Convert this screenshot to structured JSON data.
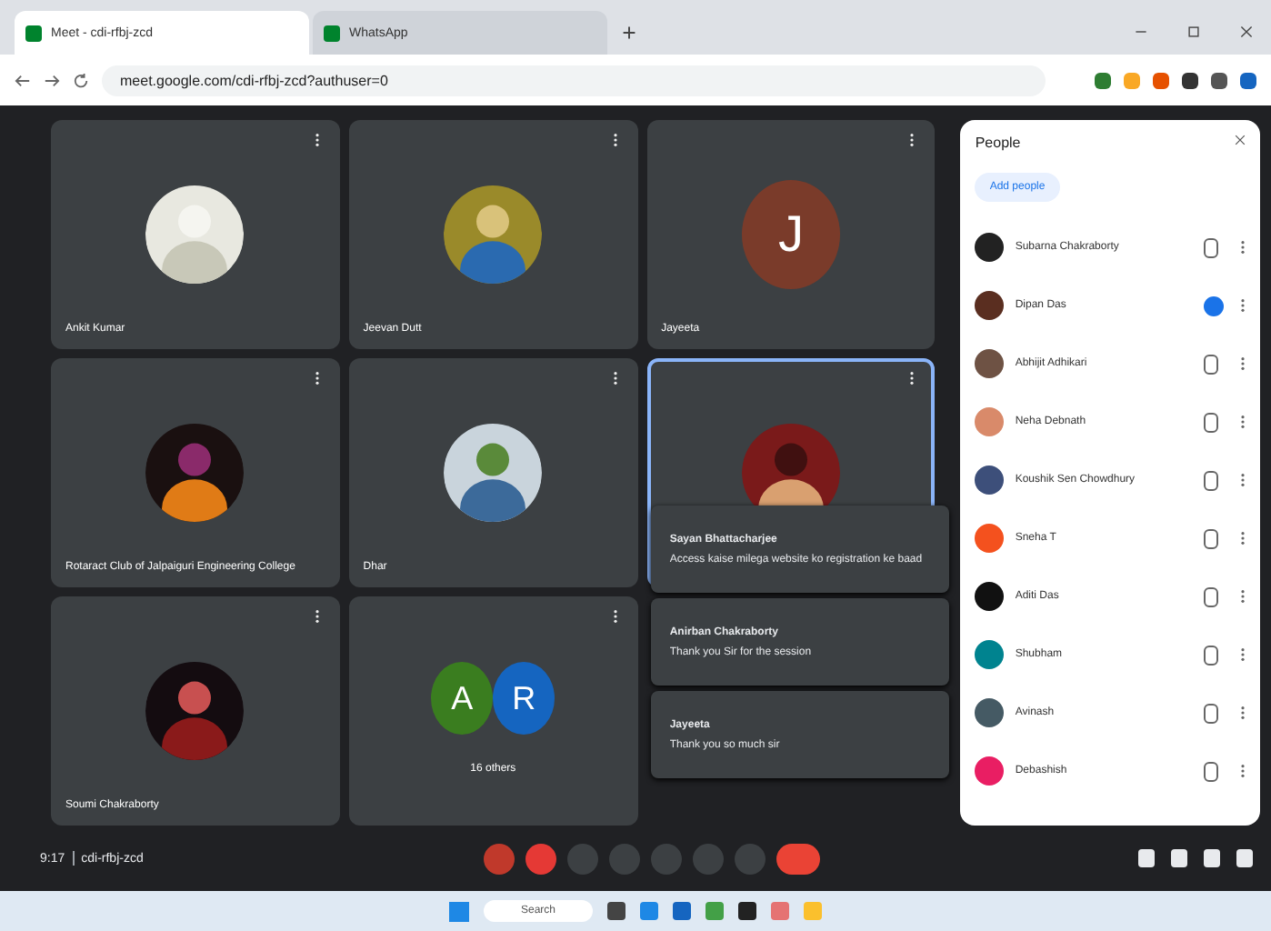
{
  "browser": {
    "tabs": [
      {
        "title": "Meet - cdi-rfbj-zcd",
        "selected": true
      },
      {
        "title": "WhatsApp",
        "selected": false
      }
    ],
    "url": "meet.google.com/cdi-rfbj-zcd?authuser=0"
  },
  "tiles": [
    {
      "name": "Ankit Kumar",
      "kind": "picture",
      "highlighted": false
    },
    {
      "name": "Jeevan Dutt",
      "kind": "picture",
      "highlighted": false
    },
    {
      "name": "Jayeeta",
      "kind": "letter",
      "letter": "J",
      "color": "#7a3b2a",
      "highlighted": false
    },
    {
      "name": "Rotaract Club of Jalpaiguri Engineering College",
      "kind": "picture",
      "highlighted": false
    },
    {
      "name": "Dhar",
      "kind": "picture",
      "highlighted": false
    },
    {
      "kind": "picture",
      "highlighted": true
    },
    {
      "name": "Soumi Chakraborty",
      "kind": "picture",
      "highlighted": false
    },
    {
      "name": "16 others",
      "kind": "group",
      "letters": [
        {
          "letter": "A",
          "color": "#3a7d1f"
        },
        {
          "letter": "R",
          "color": "#1565c0"
        }
      ],
      "highlighted": false
    }
  ],
  "messages": [
    {
      "sender": "Sayan Bhattacharjee",
      "text": "Access kaise milega website ko registration ke baad"
    },
    {
      "sender": "Anirban Chakraborty",
      "text": "Thank you Sir for the session"
    },
    {
      "sender": "Jayeeta",
      "text": "Thank you so much sir"
    }
  ],
  "meeting": {
    "time": "9:17",
    "code": "cdi-rfbj-zcd"
  },
  "people": {
    "title": "People",
    "add": "Add people",
    "list": [
      {
        "name": "Subarna Chakraborty",
        "color": "#222222",
        "speaking": false
      },
      {
        "name": "Dipan Das",
        "color": "#5a2e20",
        "speaking": true
      },
      {
        "name": "Abhijit Adhikari",
        "color": "#6e5244",
        "speaking": false
      },
      {
        "name": "Neha Debnath",
        "color": "#d98a6a",
        "speaking": false
      },
      {
        "name": "Koushik Sen Chowdhury",
        "color": "#3d4f7a",
        "speaking": false
      },
      {
        "name": "Sneha T",
        "color": "#f4511e",
        "speaking": false
      },
      {
        "name": "Aditi Das",
        "color": "#111111",
        "speaking": false
      },
      {
        "name": "Shubham",
        "color": "#00838f",
        "speaking": false
      },
      {
        "name": "Avinash",
        "color": "#455a64",
        "speaking": false
      },
      {
        "name": "Debashish",
        "color": "#e91e63",
        "speaking": false
      }
    ]
  },
  "taskbar": {
    "search": "Search"
  }
}
